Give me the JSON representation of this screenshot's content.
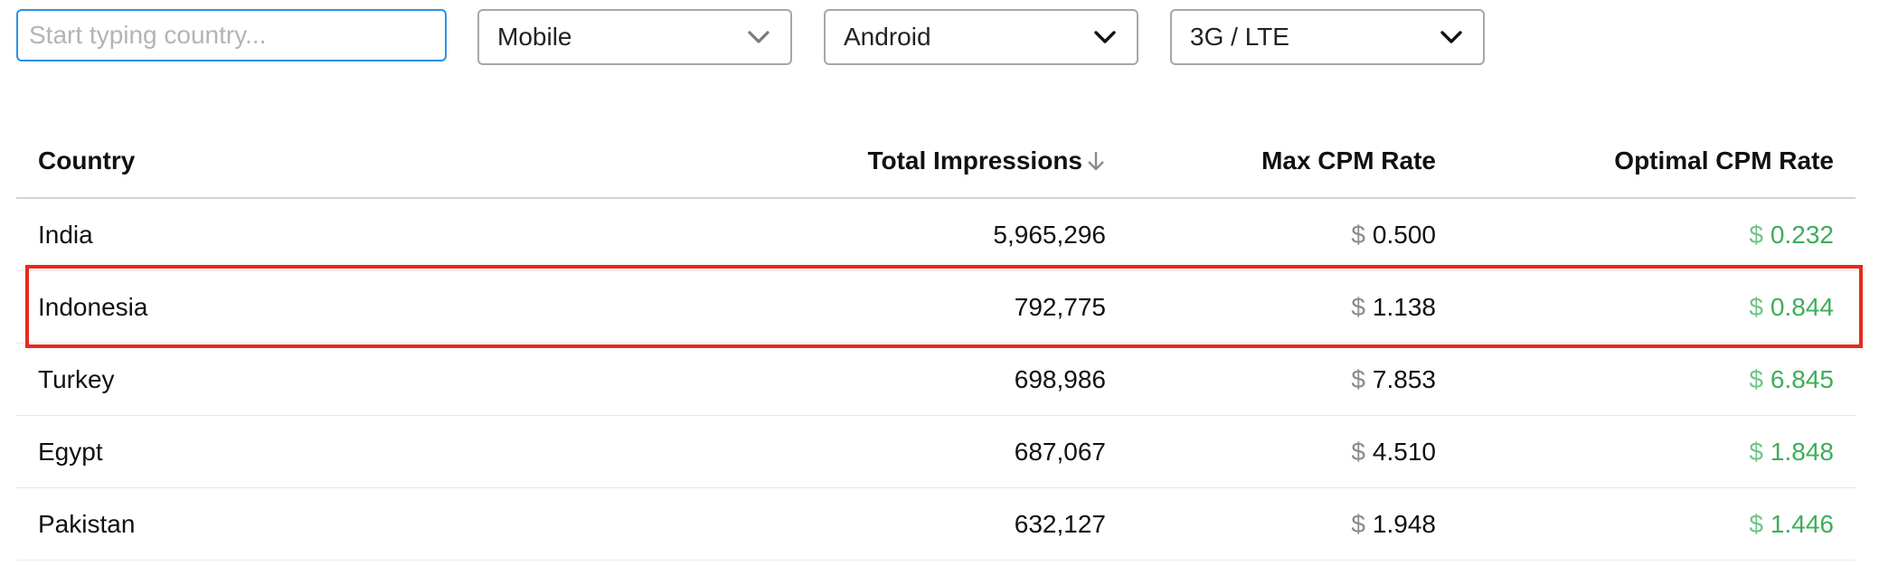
{
  "filters": {
    "country_search": {
      "placeholder": "Start typing country...",
      "value": ""
    },
    "device": {
      "selected": "Mobile"
    },
    "os": {
      "selected": "Android"
    },
    "network": {
      "selected": "3G / LTE"
    }
  },
  "table": {
    "columns": {
      "country": "Country",
      "impressions": "Total Impressions",
      "max_cpm": "Max CPM Rate",
      "optimal_cpm": "Optimal CPM Rate"
    },
    "sort": {
      "column": "impressions",
      "direction": "descending"
    },
    "currency_symbol": "$",
    "rows": [
      {
        "country": "India",
        "impressions": "5,965,296",
        "max_cpm": "0.500",
        "optimal_cpm": "0.232"
      },
      {
        "country": "Indonesia",
        "impressions": "792,775",
        "max_cpm": "1.138",
        "optimal_cpm": "0.844",
        "highlighted": true
      },
      {
        "country": "Turkey",
        "impressions": "698,986",
        "max_cpm": "7.853",
        "optimal_cpm": "6.845"
      },
      {
        "country": "Egypt",
        "impressions": "687,067",
        "max_cpm": "4.510",
        "optimal_cpm": "1.848"
      },
      {
        "country": "Pakistan",
        "impressions": "632,127",
        "max_cpm": "1.948",
        "optimal_cpm": "1.446"
      }
    ]
  },
  "colors": {
    "input_focus_border": "#2a8fe8",
    "select_border": "#a7a7a7",
    "optimal_rate_green": "#3eae5a",
    "highlight_red": "#e62a1c"
  },
  "icons": {
    "dropdown": "chevron-down-icon",
    "sort": "arrow-down-icon"
  }
}
